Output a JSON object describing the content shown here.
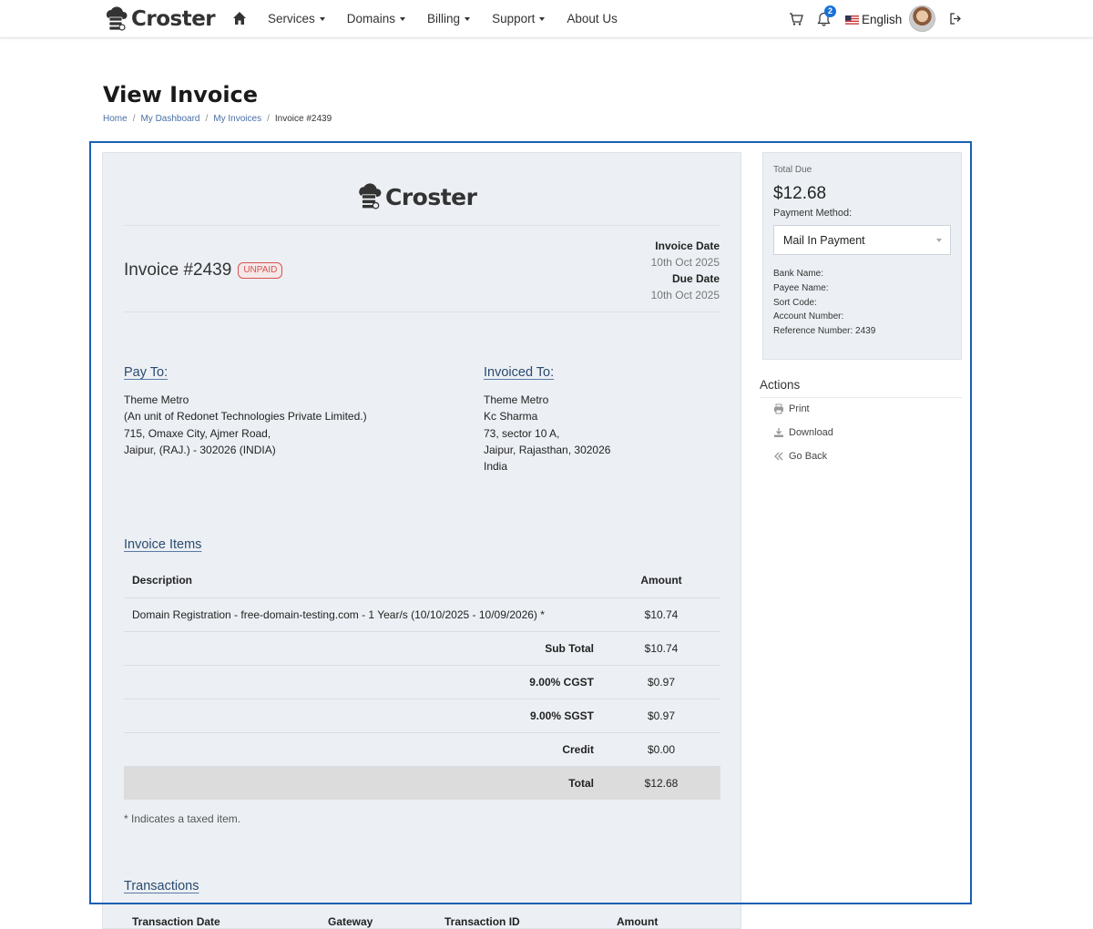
{
  "brand": {
    "name": "Croster",
    "accent": "#1a6fd8"
  },
  "nav": {
    "items": [
      {
        "label": "Services",
        "has_dropdown": true
      },
      {
        "label": "Domains",
        "has_dropdown": true
      },
      {
        "label": "Billing",
        "has_dropdown": true
      },
      {
        "label": "Support",
        "has_dropdown": true
      },
      {
        "label": "About Us",
        "has_dropdown": false
      }
    ],
    "notification_count": "2",
    "language": "English"
  },
  "page": {
    "title": "View Invoice",
    "breadcrumb": [
      "Home",
      "My Dashboard",
      "My Invoices",
      "Invoice #2439"
    ]
  },
  "invoice": {
    "number": "Invoice #2439",
    "status": "UNPAID",
    "invoice_date_label": "Invoice Date",
    "invoice_date": "10th Oct 2025",
    "due_date_label": "Due Date",
    "due_date": "10th Oct 2025",
    "pay_to": {
      "heading": "Pay To:",
      "lines": [
        "Theme Metro",
        "(An unit of Redonet Technologies Private Limited.)",
        "715, Omaxe City, Ajmer Road,",
        "Jaipur, (RAJ.) - 302026 (INDIA)"
      ]
    },
    "invoiced_to": {
      "heading": "Invoiced To:",
      "lines": [
        "Theme Metro",
        "Kc Sharma",
        "73, sector 10 A,",
        "Jaipur, Rajasthan, 302026",
        "India"
      ]
    },
    "items_heading": "Invoice Items",
    "columns": {
      "description": "Description",
      "amount": "Amount"
    },
    "items": [
      {
        "description": "Domain Registration - free-domain-testing.com - 1 Year/s (10/10/2025 - 10/09/2026) *",
        "amount": "$10.74"
      }
    ],
    "summary": [
      {
        "label": "Sub Total",
        "amount": "$10.74"
      },
      {
        "label": "9.00% CGST",
        "amount": "$0.97"
      },
      {
        "label": "9.00% SGST",
        "amount": "$0.97"
      },
      {
        "label": "Credit",
        "amount": "$0.00"
      }
    ],
    "total": {
      "label": "Total",
      "amount": "$12.68"
    },
    "tax_note": "* Indicates a taxed item.",
    "transactions_heading": "Transactions",
    "transaction_columns": [
      "Transaction Date",
      "Gateway",
      "Transaction ID",
      "Amount"
    ]
  },
  "sidebar": {
    "total_due_label": "Total Due",
    "total_due": "$12.68",
    "payment_method_label": "Payment Method:",
    "payment_method": "Mail In Payment",
    "bank_fields": [
      "Bank Name:",
      "Payee Name:",
      "Sort Code:",
      "Account Number:",
      "Reference Number: 2439"
    ],
    "actions_title": "Actions",
    "actions": [
      {
        "label": "Print",
        "icon": "print-icon"
      },
      {
        "label": "Download",
        "icon": "download-icon"
      },
      {
        "label": "Go Back",
        "icon": "double-chevron-left-icon"
      }
    ]
  }
}
